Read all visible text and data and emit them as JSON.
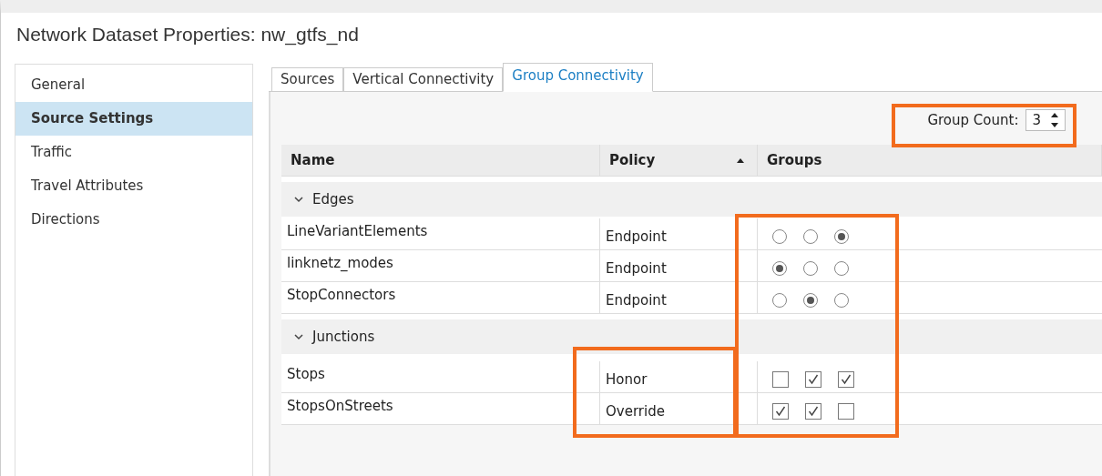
{
  "window": {
    "title": "Network Dataset Properties: nw_gtfs_nd"
  },
  "sidebar": {
    "items": [
      {
        "label": "General",
        "selected": false
      },
      {
        "label": "Source Settings",
        "selected": true
      },
      {
        "label": "Traffic",
        "selected": false
      },
      {
        "label": "Travel Attributes",
        "selected": false
      },
      {
        "label": "Directions",
        "selected": false
      }
    ]
  },
  "tabs": [
    {
      "label": "Sources",
      "selected": false
    },
    {
      "label": "Vertical Connectivity",
      "selected": false
    },
    {
      "label": "Group Connectivity",
      "selected": true
    }
  ],
  "group_count": {
    "label": "Group Count:",
    "value": "3"
  },
  "table": {
    "columns": [
      {
        "label": "Name"
      },
      {
        "label": "Policy",
        "sorted": true
      },
      {
        "label": "Groups"
      }
    ],
    "groups": [
      {
        "name": "Edges",
        "expanded": true,
        "kind": "radio",
        "rows": [
          {
            "name": "LineVariantElements",
            "policy": "Endpoint",
            "options": [
              {
                "selected": false
              },
              {
                "selected": false
              },
              {
                "selected": true
              }
            ]
          },
          {
            "name": "linknetz_modes",
            "policy": "Endpoint",
            "options": [
              {
                "selected": true
              },
              {
                "selected": false
              },
              {
                "selected": false
              }
            ]
          },
          {
            "name": "StopConnectors",
            "policy": "Endpoint",
            "options": [
              {
                "selected": false
              },
              {
                "selected": true
              },
              {
                "selected": false
              }
            ]
          }
        ]
      },
      {
        "name": "Junctions",
        "expanded": true,
        "kind": "checkbox",
        "rows": [
          {
            "name": "Stops",
            "policy": "Honor",
            "options": [
              {
                "checked": false
              },
              {
                "checked": true
              },
              {
                "checked": true
              }
            ]
          },
          {
            "name": "StopsOnStreets",
            "policy": "Override",
            "options": [
              {
                "checked": true
              },
              {
                "checked": true
              },
              {
                "checked": false
              }
            ]
          }
        ]
      }
    ]
  }
}
